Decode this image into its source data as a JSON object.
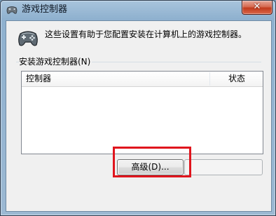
{
  "window": {
    "title": "游戏控制器",
    "close_label": "✕"
  },
  "intro": {
    "text": "这些设置有助于您配置安装在计算机上的游戏控制器。"
  },
  "group": {
    "label": "安装游戏控制器(N)"
  },
  "list": {
    "columns": [
      "控制器",
      "状态"
    ],
    "rows": []
  },
  "buttons": {
    "advanced_label": "高级(D)...",
    "properties_label": ""
  },
  "colors": {
    "highlight": "#e0151d",
    "close_button": "#c13b1d"
  },
  "icons": [
    "gamepad-icon",
    "close-icon"
  ]
}
